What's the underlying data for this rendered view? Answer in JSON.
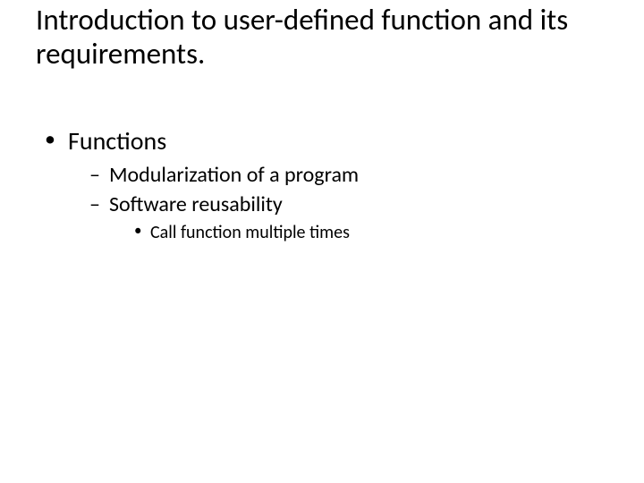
{
  "title": "Introduction to user-defined function and its requirements.",
  "bullets": {
    "l1": [
      {
        "text": "Functions"
      }
    ],
    "l2": [
      {
        "text": "Modularization of a program"
      },
      {
        "text": "Software reusability"
      }
    ],
    "l3": [
      {
        "text": "Call function multiple times"
      }
    ]
  }
}
